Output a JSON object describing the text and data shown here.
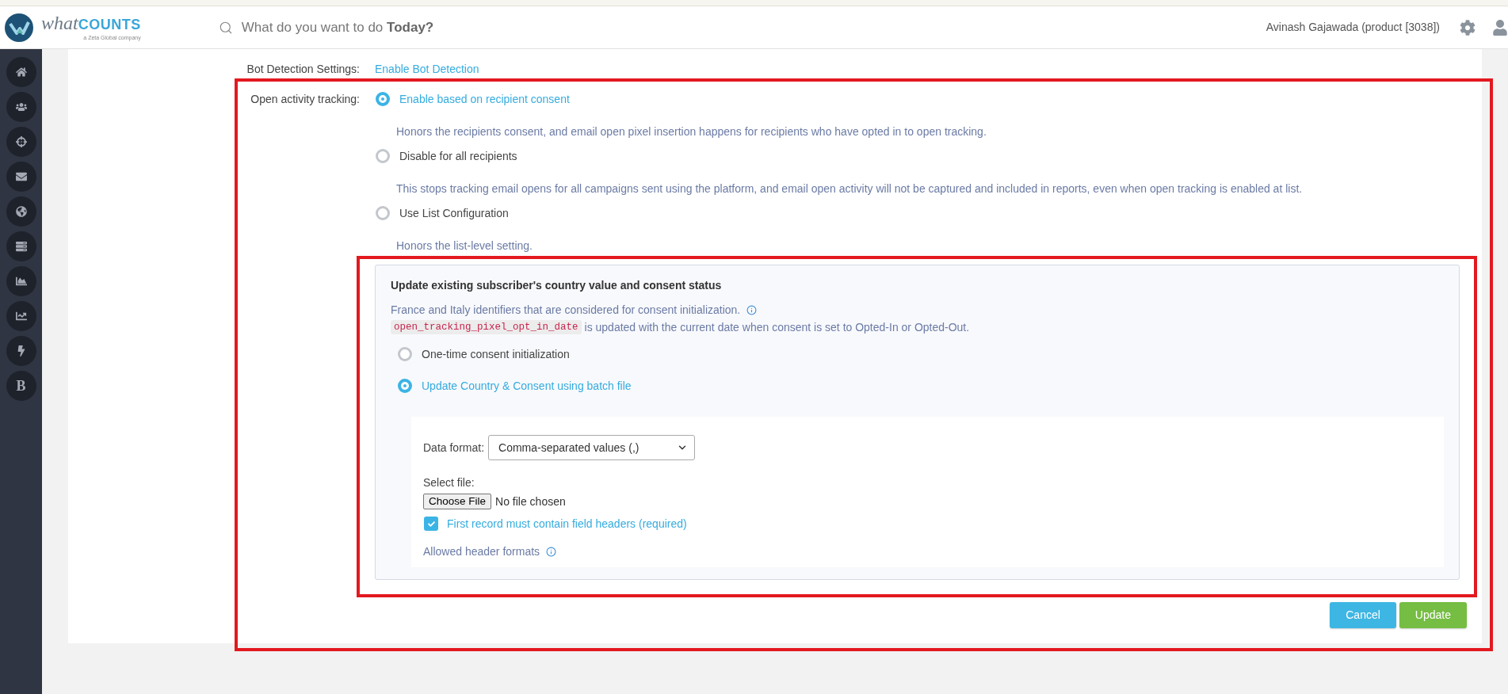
{
  "header": {
    "logo": {
      "light_part": "what",
      "bold_part": "COUNTS",
      "tagline": "a Zeta Global company"
    },
    "search": {
      "prompt": "What do you want to do **Today?**"
    },
    "user": "Avinash Gajawada (product [3038])"
  },
  "sidebar": {
    "items": [
      {
        "kind": "icon"
      },
      {
        "kind": "icon"
      },
      {
        "kind": "icon"
      },
      {
        "kind": "icon"
      },
      {
        "kind": "icon"
      },
      {
        "kind": "icon"
      },
      {
        "kind": "icon"
      },
      {
        "kind": "icon"
      },
      {
        "kind": "icon"
      },
      {
        "kind": "letter",
        "label": "B"
      }
    ]
  },
  "settings": [
    {
      "label": "Bot Detection Settings:",
      "link": "Enable Bot Detection"
    }
  ],
  "open_activity_tracking": {
    "label": "Open activity tracking:",
    "options": [
      {
        "label": "Enable based on recipient consent",
        "selected": true,
        "description": "Honors the recipients consent, and email open pixel insertion happens for recipients who have opted in to open tracking."
      },
      {
        "label": "Disable for all recipients",
        "selected": false,
        "description": "This stops tracking email opens for all campaigns sent using the platform, and email open activity will not be captured and included in reports, even when open tracking is enabled at list."
      },
      {
        "label": "Use List Configuration",
        "selected": false,
        "description": "Honors the list-level setting."
      }
    ]
  },
  "consent_panel": {
    "title": "Update existing subscriber's country value and consent status",
    "note": "France and Italy identifiers that are considered for consent initialization.",
    "code": "open_tracking_pixel_opt_in_date",
    "code_note": "is updated with the current date when consent is set to Opted-In or Opted-Out.",
    "options": [
      {
        "label": "One-time consent initialization",
        "selected": false
      },
      {
        "label": "Update Country & Consent using batch file",
        "selected": true
      }
    ],
    "batch": {
      "data_format_label": "Data format:",
      "data_format_value": "Comma-separated values (,)",
      "select_file_label": "Select file:",
      "file_button": "Choose File",
      "file_status": "No file chosen",
      "headers_checkbox": {
        "label": "First record must contain field headers (required)",
        "checked": true
      },
      "allowed_formats": "Allowed header formats"
    }
  },
  "buttons": [
    {
      "label": "Cancel",
      "kind": "cancel"
    },
    {
      "label": "Update",
      "kind": "confirm"
    }
  ]
}
